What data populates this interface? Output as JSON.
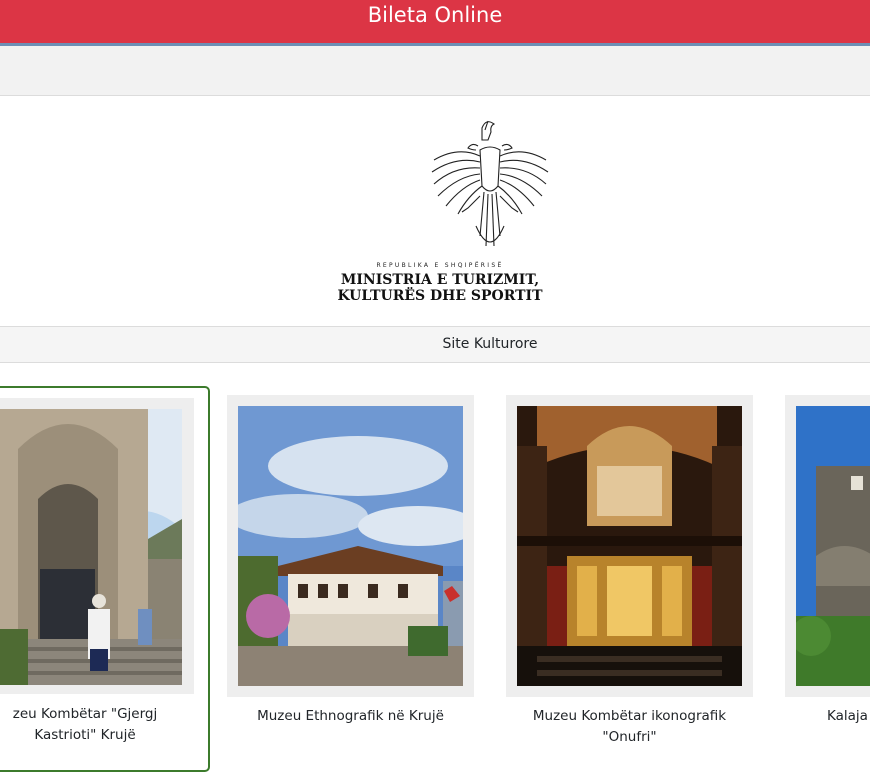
{
  "header": {
    "title": "Bileta Online"
  },
  "branding": {
    "republika": "REPUBLIKA E SHQIPËRISË",
    "ministry_line1": "MINISTRIA E TURIZMIT,",
    "ministry_line2": "KULTURËS DHE SPORTIT"
  },
  "section": {
    "label": "Site Kulturore"
  },
  "sites": [
    {
      "title_line1": "zeu Kombëtar \"Gjergj",
      "title_line2": "Kastrioti\" Krujë"
    },
    {
      "title_line1": "Muzeu Ethnografik në Krujë",
      "title_line2": ""
    },
    {
      "title_line1": "Muzeu Kombëtar ikonografik",
      "title_line2": "\"Onufri\""
    },
    {
      "title_line1": "Kalaja",
      "title_line2": ""
    }
  ],
  "colors": {
    "topbar": "#dc3545",
    "selected_border": "#3c7b2c"
  }
}
